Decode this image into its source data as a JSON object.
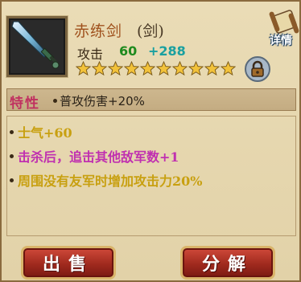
{
  "item": {
    "name": "赤练剑",
    "type": "(剑)",
    "attack_label": "攻击",
    "attack_base": "60",
    "attack_bonus": "+288",
    "stars": 10,
    "stars_filled": 10
  },
  "detail_label": "详情",
  "trait": {
    "label": "特性",
    "value": "普攻伤害+20%"
  },
  "effects": [
    {
      "text": "士气+60",
      "color": "#c8a010"
    },
    {
      "text": "击杀后，追击其他敌军数+1",
      "color": "#c030b0"
    },
    {
      "text": "周围没有友军时增加攻击力20%",
      "color": "#c8a010"
    }
  ],
  "buttons": {
    "sell": "出售",
    "decompose": "分解"
  },
  "colors": {
    "star": "#f2c23a",
    "button_red": "#a02a1e"
  }
}
